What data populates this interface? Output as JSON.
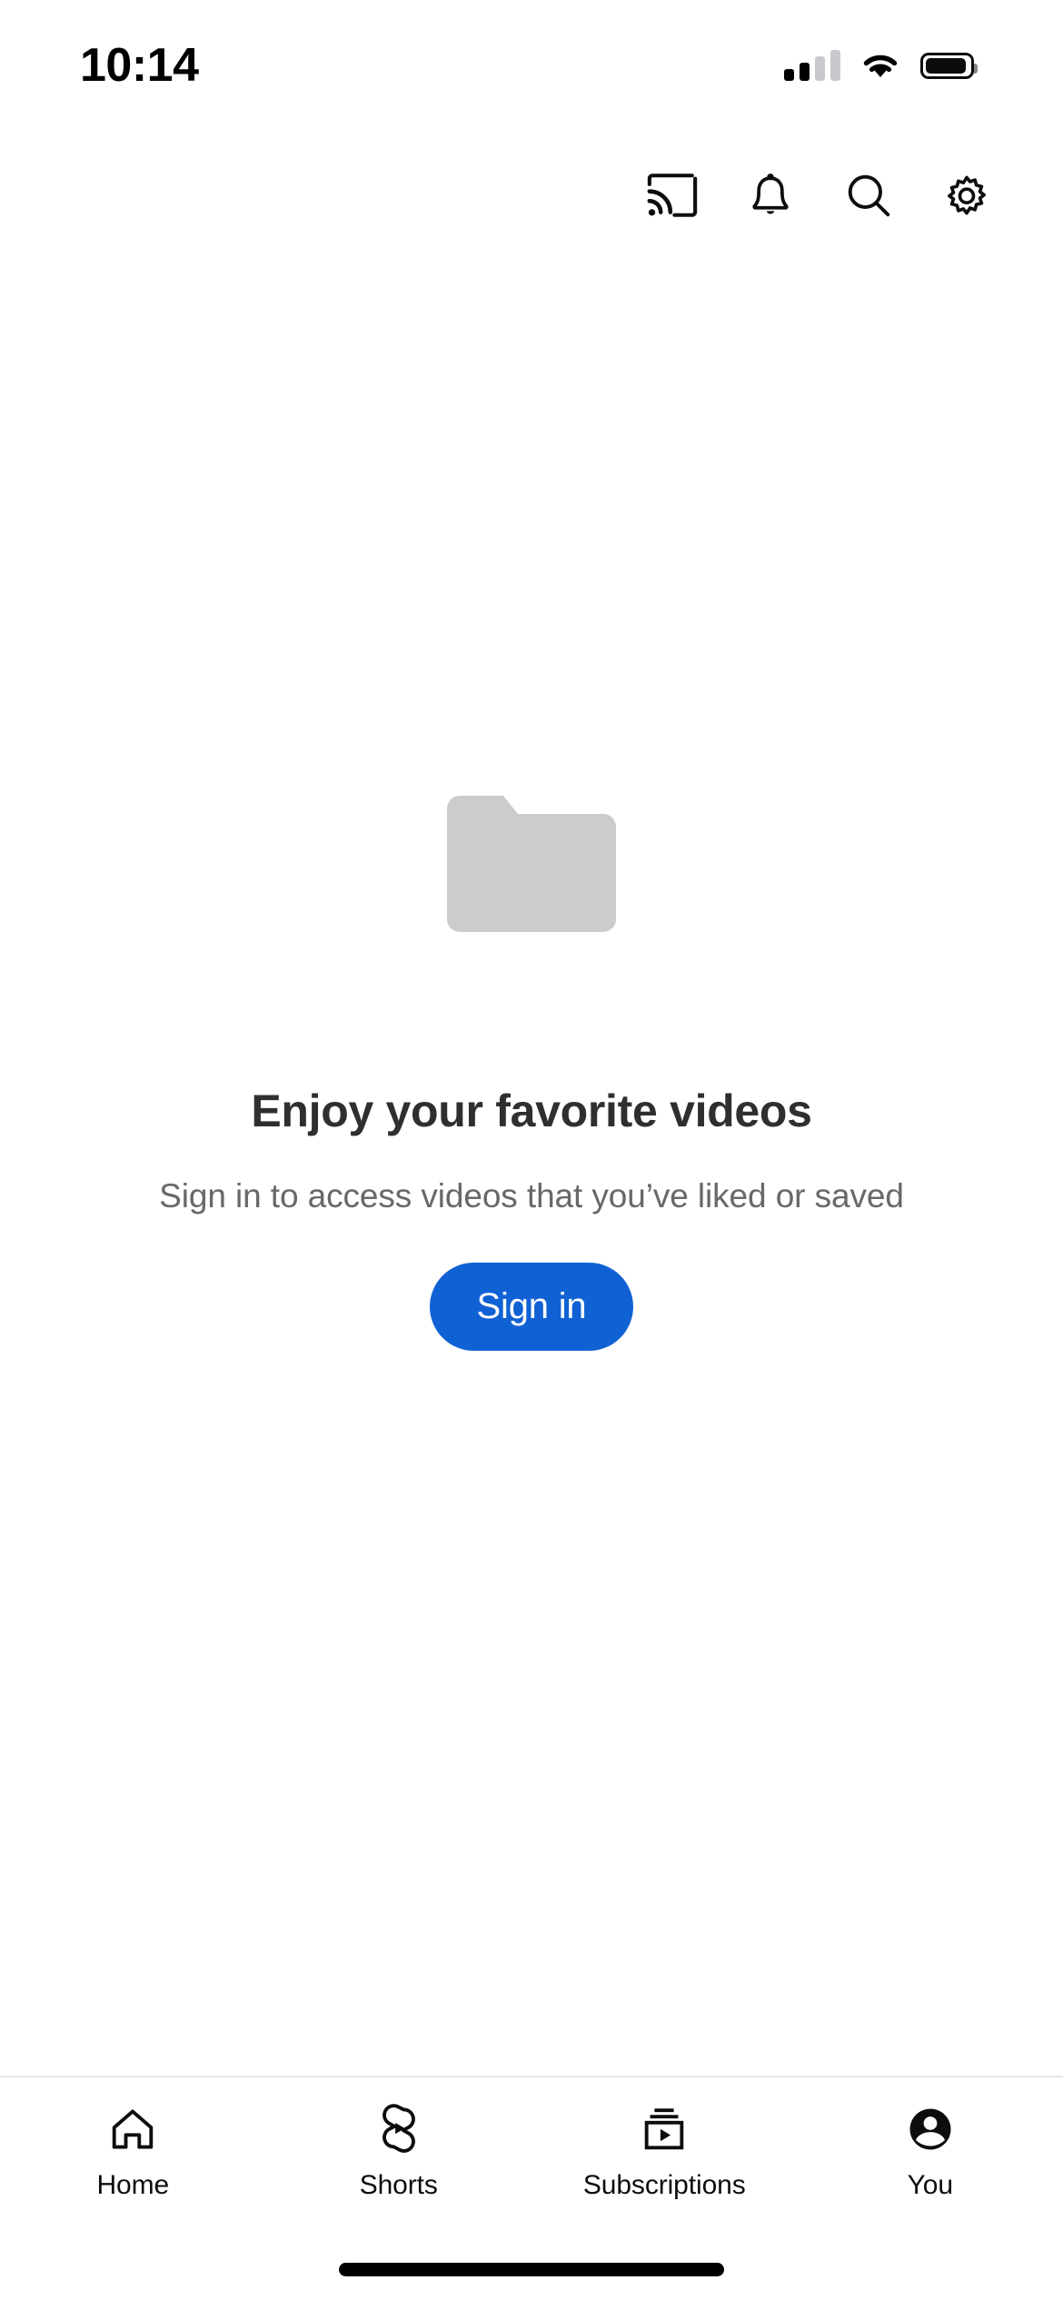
{
  "status_bar": {
    "time": "10:14",
    "signal_icon": "cellular-signal-icon",
    "signal_bars_filled": 2,
    "signal_bars_total": 4,
    "wifi_icon": "wifi-icon",
    "battery_icon": "battery-icon"
  },
  "toolbar": {
    "items": [
      {
        "name": "cast-icon",
        "label": "Cast"
      },
      {
        "name": "notifications-bell-icon",
        "label": "Notifications"
      },
      {
        "name": "search-icon",
        "label": "Search"
      },
      {
        "name": "settings-gear-icon",
        "label": "Settings"
      }
    ]
  },
  "empty_state": {
    "illustration": "folder-icon",
    "illustration_color": "#cccccc",
    "headline": "Enjoy your favorite videos",
    "subtitle": "Sign in to access videos that you’ve liked or saved",
    "button_label": "Sign in",
    "button_color": "#1061d4",
    "headline_color": "#2f2f2f",
    "subtitle_color": "#686868"
  },
  "bottom_nav": {
    "active_index": 3,
    "items": [
      {
        "label": "Home",
        "icon": "home-icon",
        "active": false
      },
      {
        "label": "Shorts",
        "icon": "shorts-icon",
        "active": false
      },
      {
        "label": "Subscriptions",
        "icon": "subscriptions-icon",
        "active": false
      },
      {
        "label": "You",
        "icon": "account-avatar-icon",
        "active": true
      }
    ]
  },
  "system": {
    "home_indicator": "home-indicator"
  }
}
